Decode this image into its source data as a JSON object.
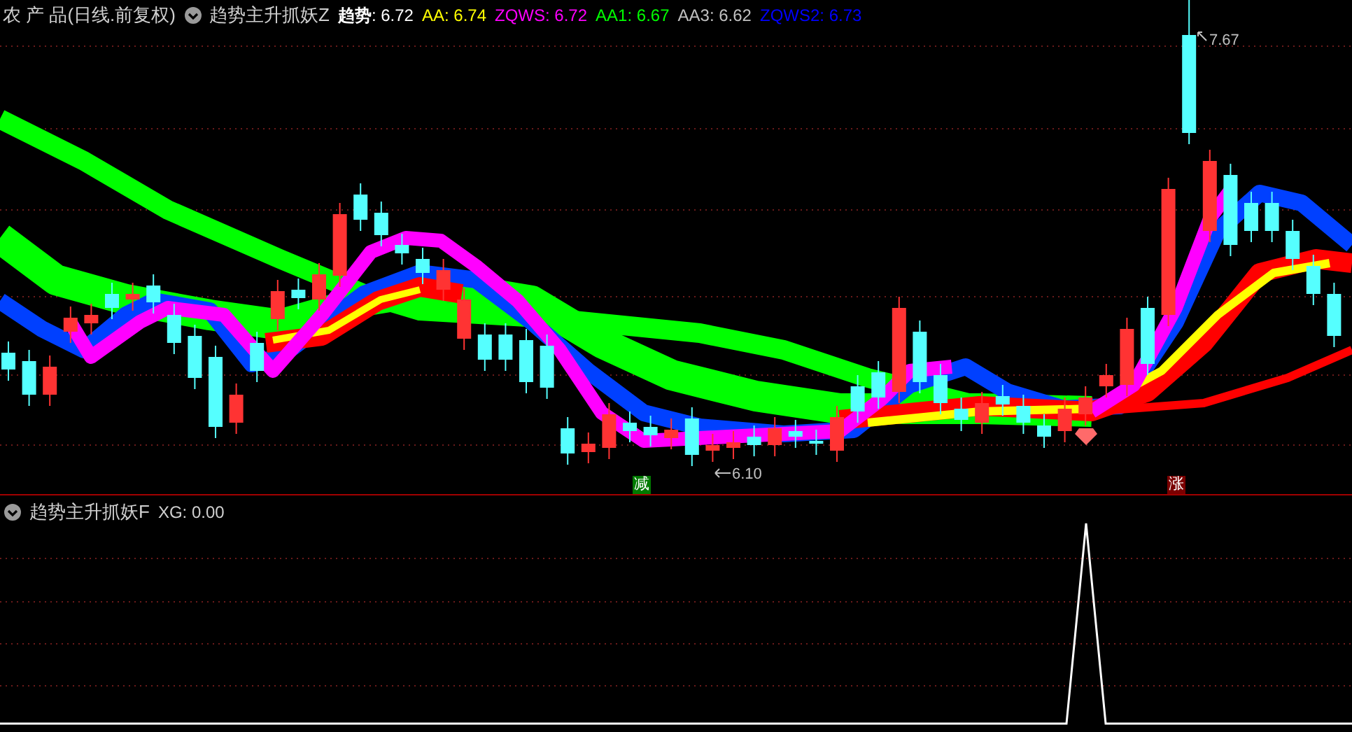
{
  "main_panel": {
    "title": "农 产 品(日线.前复权)",
    "indicator_name": "趋势主升抓妖Z",
    "indicators": [
      {
        "text": "**趋势**: 6.72",
        "color": "#ffffff"
      },
      {
        "text": "AA: 6.74",
        "color": "#ffff00"
      },
      {
        "text": "ZQWS: 6.72",
        "color": "#ff00ff"
      },
      {
        "text": "AA1: 6.67",
        "color": "#00ff00"
      },
      {
        "text": "AA3: 6.62",
        "color": "#c0c0c0"
      },
      {
        "text": "ZQWS2: 6.73",
        "color": "#0000ff"
      }
    ],
    "high_label": "7.67",
    "low_label": "6.10",
    "signals": [
      {
        "text": "减",
        "kind": "sell"
      },
      {
        "text": "涨",
        "kind": "buy"
      }
    ]
  },
  "sub_panel": {
    "indicator_name": "趋势主升抓妖F",
    "reading": "XG: 0.00"
  }
}
